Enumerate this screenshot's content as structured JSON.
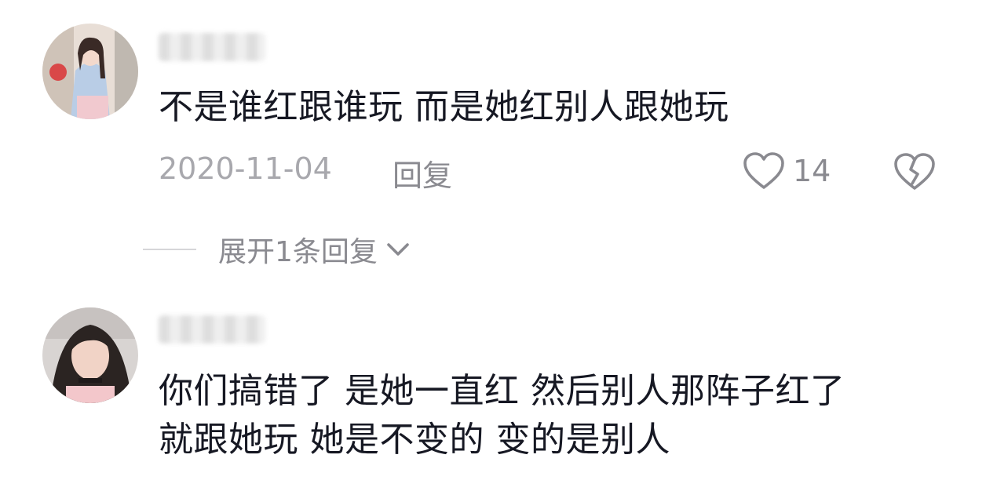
{
  "comments": [
    {
      "text": "不是谁红跟谁玩 而是她红别人跟她玩",
      "date": "2020-11-04",
      "reply_label": "回复",
      "likes": "14",
      "expand_replies": "展开1条回复"
    },
    {
      "text": "你们搞错了 是她一直红 然后别人那阵子红了\n就跟她玩 她是不变的 变的是别人"
    }
  ],
  "icons": {
    "like": "heart-outline-icon",
    "dislike": "broken-heart-icon",
    "expand": "chevron-down-icon"
  },
  "colors": {
    "text_primary": "#161823",
    "text_secondary": "#8a8a90",
    "text_date": "#a8a8ad"
  }
}
